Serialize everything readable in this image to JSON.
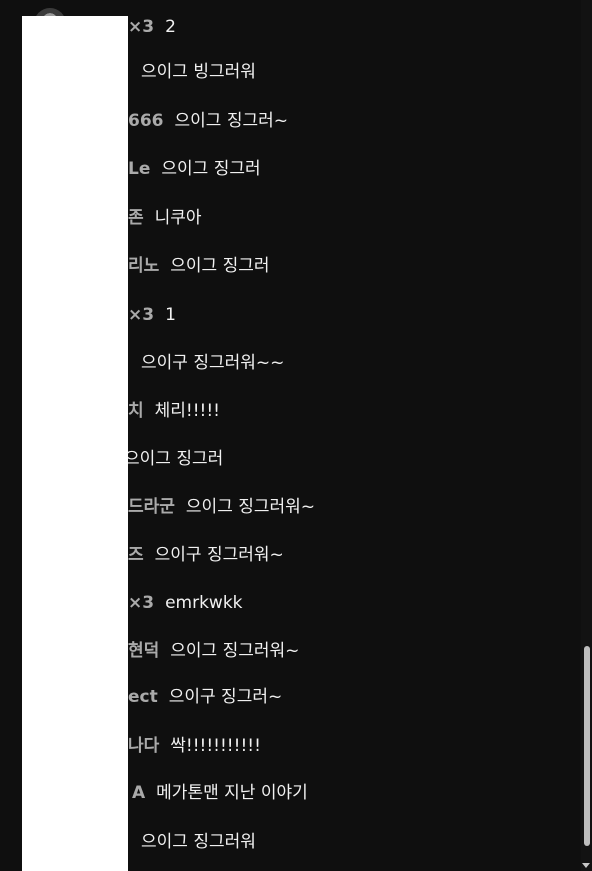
{
  "chat": {
    "messages": [
      {
        "author": "×3",
        "text": "2"
      },
      {
        "author": "",
        "text": "으이그 빙그러워"
      },
      {
        "author": "666",
        "text": "으이그 징그러~"
      },
      {
        "author": "Le",
        "text": "으이그 징그러"
      },
      {
        "author": "존",
        "text": "니쿠아"
      },
      {
        "author": "리노",
        "text": "으이그 징그러"
      },
      {
        "author": "×3",
        "text": "1"
      },
      {
        "author": "",
        "text": "으이구 징그러워~~"
      },
      {
        "author": "치",
        "text": "체리!!!!!"
      },
      {
        "author": "",
        "text": "으이그 징그러"
      },
      {
        "author": "드라군",
        "text": "으이그 징그러워~"
      },
      {
        "author": "즈",
        "text": "으이구 징그러워~"
      },
      {
        "author": "×3",
        "text": "emrkwkk"
      },
      {
        "author": "현덕",
        "text": "으이그 징그러워~"
      },
      {
        "author": "ect",
        "text": "으이구 징그러~"
      },
      {
        "author": "나다",
        "text": "싹!!!!!!!!!!!"
      },
      {
        "author": "A",
        "text": "메가톤맨 지난 이야기"
      },
      {
        "author": "",
        "text": "으이그 징그러워"
      }
    ]
  }
}
